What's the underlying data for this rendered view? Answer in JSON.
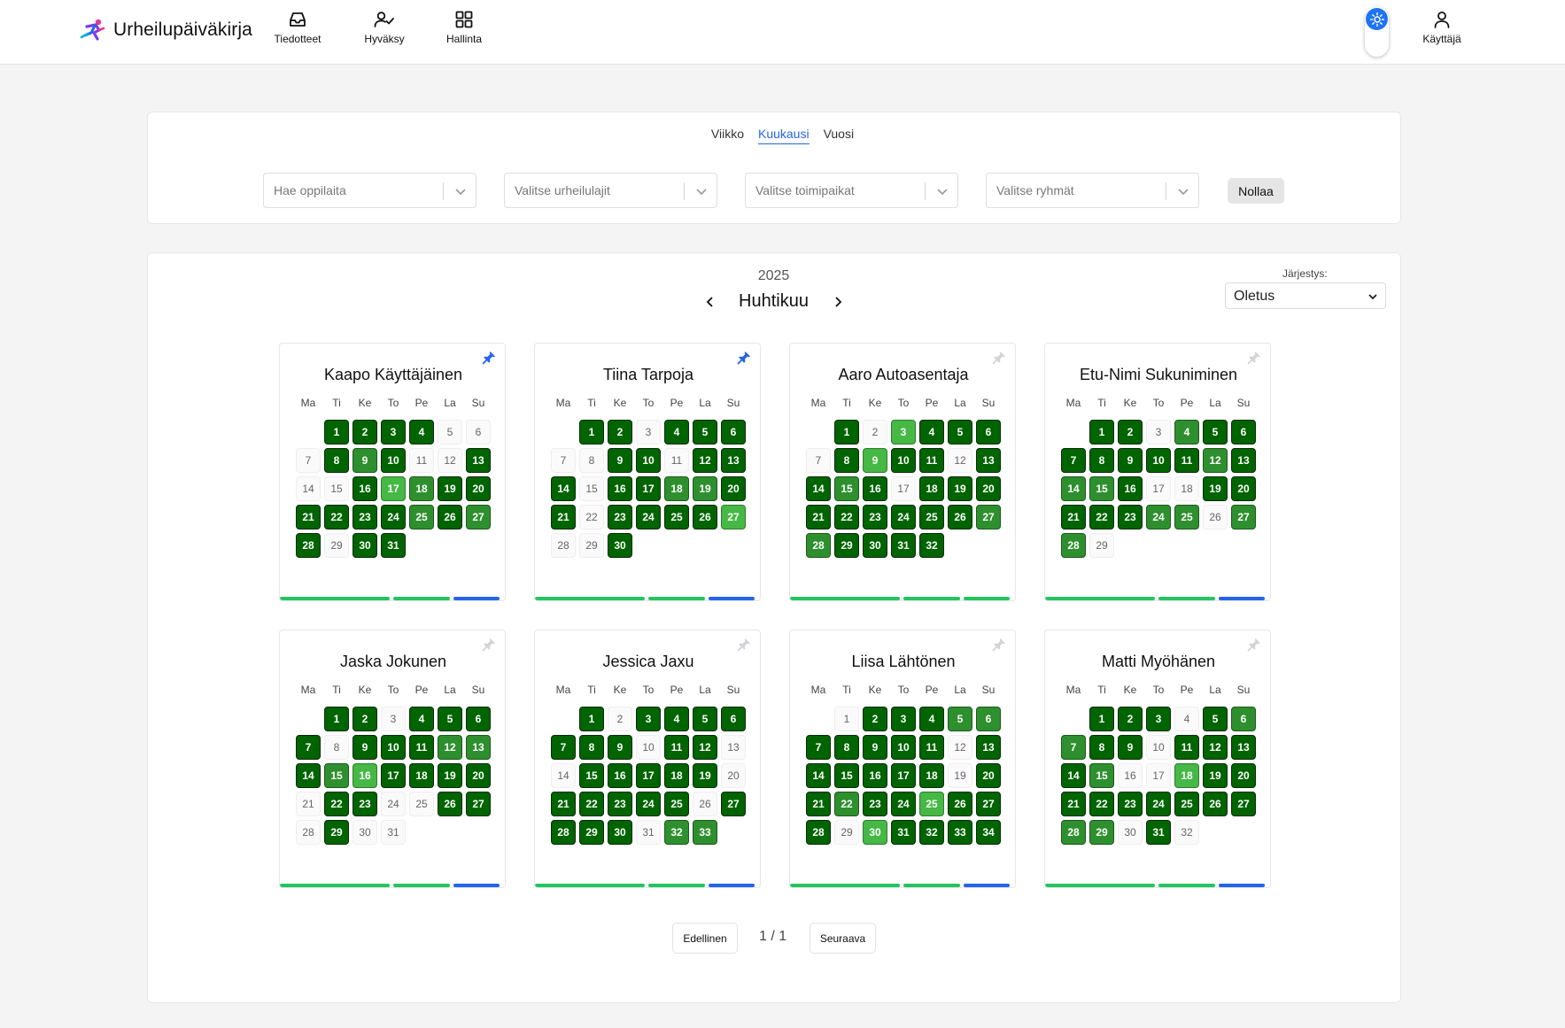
{
  "app": {
    "title": "Urheilupäiväkirja"
  },
  "nav": {
    "items": [
      {
        "label": "Tiedotteet",
        "icon": "inbox-icon"
      },
      {
        "label": "Hyväksy",
        "icon": "user-check-icon"
      },
      {
        "label": "Hallinta",
        "icon": "grid-icon"
      }
    ],
    "user_label": "Käyttäjä"
  },
  "view_tabs": {
    "items": [
      "Viikko",
      "Kuukausi",
      "Vuosi"
    ],
    "active": "Kuukausi"
  },
  "filters": {
    "students_placeholder": "Hae oppilaita",
    "sports_placeholder": "Valitse urheilulajit",
    "venues_placeholder": "Valitse toimipaikat",
    "groups_placeholder": "Valitse ryhmät",
    "reset_label": "Nollaa"
  },
  "calendar_header": {
    "year": "2025",
    "month": "Huhtikuu"
  },
  "sort": {
    "label": "Järjestys:",
    "value": "Oletus"
  },
  "weekday_labels": [
    "Ma",
    "Ti",
    "Ke",
    "To",
    "Pe",
    "La",
    "Su"
  ],
  "month_start_offset": 1,
  "colors": {
    "dark_green": "#006400",
    "medium_green": "#2e8f2e",
    "light_green": "#45b845",
    "bar_green": "#22c55e",
    "bar_blue": "#2563eb",
    "pin_active": "#2563eb",
    "pin_inactive": "#d4d4d8",
    "accent": "#2563eb"
  },
  "status_legend": {
    "d": "dark green",
    "m": "medium green",
    "l": "light green",
    "e": "no entry"
  },
  "students": [
    {
      "name": "Kaapo Käyttäjäinen",
      "pinned": true,
      "days": "ddddeeedmdeedeedlmddddddmdmdedd",
      "bars": [
        "green",
        "green",
        "blue"
      ]
    },
    {
      "name": "Tiina Tarpoja",
      "pinned": true,
      "days": "ddedddeeddedddeddmmddeddddleed",
      "bars": [
        "green",
        "green",
        "blue"
      ]
    },
    {
      "name": "Aaro Autoasentaja",
      "pinned": false,
      "days": "deldddedlddeddmdedddddddddmmdddd",
      "bars": [
        "green",
        "green",
        "green"
      ]
    },
    {
      "name": "Etu-Nimi Sukuniminen",
      "pinned": false,
      "days": "ddemdddddddmdmmdeedddddmmemme",
      "bars": [
        "green",
        "green",
        "blue"
      ]
    },
    {
      "name": "Jaska Jokunen",
      "pinned": false,
      "days": "ddeddddedddmmdmlddddeddeeddedee",
      "bars": [
        "green",
        "green",
        "blue"
      ]
    },
    {
      "name": "Jessica Jaxu",
      "pinned": false,
      "days": "dedddddddeddeedddddedddddeddddemm",
      "bars": [
        "green",
        "green",
        "blue"
      ]
    },
    {
      "name": "Liisa Lähtönen",
      "pinned": false,
      "days": "edddmmdddddeddddddeddmddldddeldddd",
      "bars": [
        "green",
        "green",
        "blue"
      ]
    },
    {
      "name": "Matti Myöhänen",
      "pinned": false,
      "days": "dddedmmddeddddmeeldddddddddmmede",
      "bars": [
        "green",
        "green",
        "blue"
      ]
    }
  ],
  "pagination": {
    "prev_label": "Edellinen",
    "next_label": "Seuraava",
    "info": "1 / 1"
  }
}
